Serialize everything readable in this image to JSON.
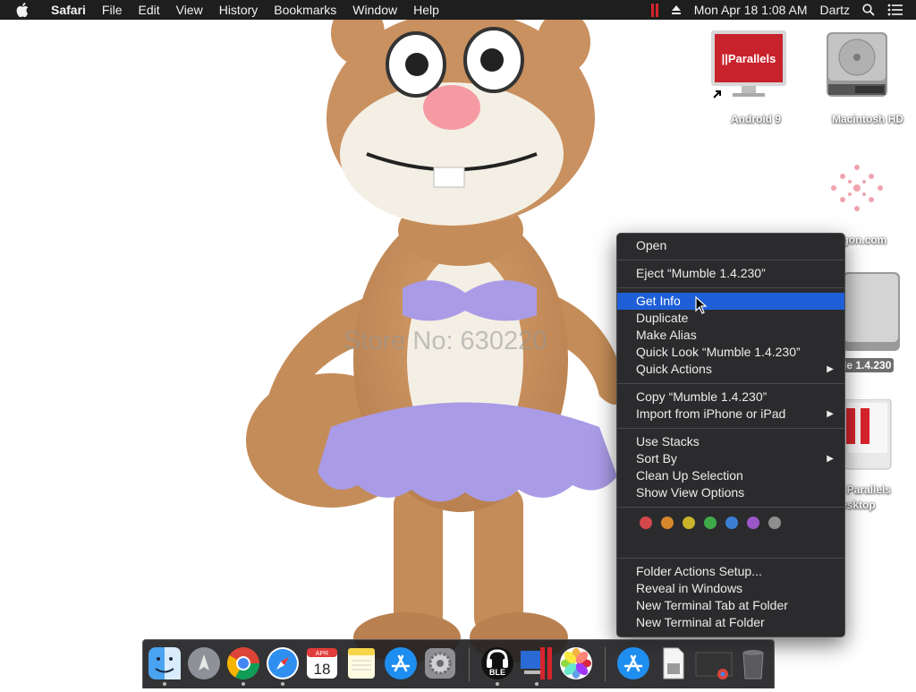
{
  "menubar": {
    "apple_icon": "apple-logo-icon",
    "app_name": "Safari",
    "menus": [
      "File",
      "Edit",
      "View",
      "History",
      "Bookmarks",
      "Window",
      "Help"
    ],
    "status_icons": [
      "parallels-status-icon",
      "eject-icon"
    ],
    "clock": "Mon Apr 18  1:08 AM",
    "user": "Dartz",
    "right_icons": [
      "spotlight-icon",
      "notification-center-icon"
    ]
  },
  "wallpaper": {
    "watermark": "Store No: 630220",
    "subject": "plush-squirrel-toy"
  },
  "desktop_icons": [
    {
      "name": "Android 9",
      "icon": "parallels-vm-icon"
    },
    {
      "name": "Macintosh HD",
      "icon": "hard-drive-icon"
    },
    {
      "name": "vagon.com",
      "icon": "pink-flower-icon"
    },
    {
      "name": "le 1.4.230",
      "icon": "disk-image-icon"
    },
    {
      "name": "l Parallels",
      "name2": "esktop",
      "icon": "parallels-desktop-icon"
    }
  ],
  "context_menu": {
    "items": [
      {
        "label": "Open"
      },
      {
        "label": "Eject “Mumble 1.4.230”"
      },
      {
        "label": "Get Info",
        "selected": true
      },
      {
        "label": "Duplicate"
      },
      {
        "label": "Make Alias"
      },
      {
        "label": "Quick Look “Mumble 1.4.230”"
      },
      {
        "label": "Quick Actions",
        "submenu": true
      },
      {
        "label": "Copy “Mumble 1.4.230”"
      },
      {
        "label": "Import from iPhone or iPad",
        "submenu": true
      },
      {
        "label": "Use Stacks"
      },
      {
        "label": "Sort By",
        "submenu": true
      },
      {
        "label": "Clean Up Selection"
      },
      {
        "label": "Show View Options"
      },
      {
        "label": "Folder Actions Setup..."
      },
      {
        "label": "Reveal in Windows"
      },
      {
        "label": "New Terminal Tab at Folder"
      },
      {
        "label": "New Terminal at Folder"
      }
    ],
    "submenu_arrow": "▶",
    "tag_colors": [
      "#d4484c",
      "#d9872c",
      "#c9b32a",
      "#3faa4a",
      "#3a7fd4",
      "#9a55c7",
      "#8e8e8e"
    ]
  },
  "dock": {
    "apps": [
      {
        "name": "finder-icon",
        "running": true
      },
      {
        "name": "launchpad-icon",
        "running": false
      },
      {
        "name": "chrome-icon",
        "running": true
      },
      {
        "name": "safari-icon",
        "running": true
      },
      {
        "name": "calendar-icon",
        "running": false,
        "month": "APR",
        "day": "18"
      },
      {
        "name": "notes-icon",
        "running": false
      },
      {
        "name": "app-store-icon",
        "running": false
      },
      {
        "name": "system-preferences-icon",
        "running": false
      },
      {
        "name": "mumble-icon",
        "running": true,
        "text": "BLE"
      },
      {
        "name": "parallels-desktop-icon",
        "running": true
      },
      {
        "name": "photos-icon",
        "running": false
      },
      {
        "name": "downloads-folder-icon",
        "running": false
      },
      {
        "name": "document-icon",
        "running": false
      },
      {
        "name": "minimized-window-icon",
        "running": false
      },
      {
        "name": "trash-icon",
        "running": false
      }
    ]
  }
}
